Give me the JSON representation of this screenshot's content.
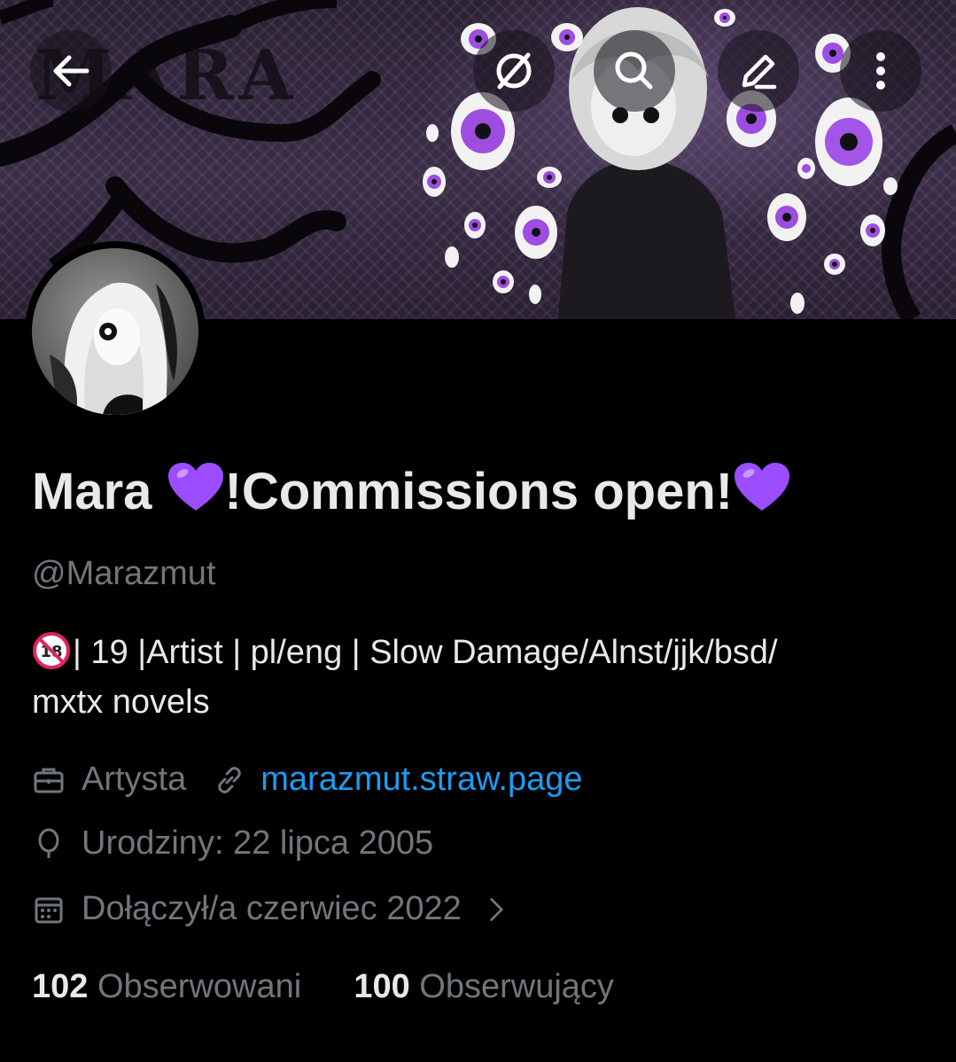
{
  "banner": {
    "logo_text": "MARA"
  },
  "topbar": {
    "back_icon": "arrow-left-icon",
    "grok_icon": "grok-slash-icon",
    "search_icon": "search-icon",
    "edit_icon": "pencil-icon",
    "more_icon": "more-vertical-icon"
  },
  "profile": {
    "name_prefix": "Mara ",
    "name_middle": "!Commissions open!",
    "name_emoji": "purple-heart",
    "handle": "@Marazmut",
    "bio_badge": "no-under-18-badge",
    "bio_line1": "| 19 |Artist | pl/eng |  Slow Damage/Alnst/jjk/bsd/",
    "bio_line2": "mxtx novels",
    "category": "Artysta",
    "link": "marazmut.straw.page",
    "birthday": "Urodziny: 22 lipca 2005",
    "joined": "Dołączył/a czerwiec 2022",
    "following_count": "102",
    "following_label": "Obserwowani",
    "followers_count": "100",
    "followers_label": "Obserwujący"
  },
  "colors": {
    "background": "#000000",
    "text_primary": "#e7e9ea",
    "text_secondary": "#71767b",
    "link": "#1d9bf0",
    "heart": "#9b4dff"
  }
}
